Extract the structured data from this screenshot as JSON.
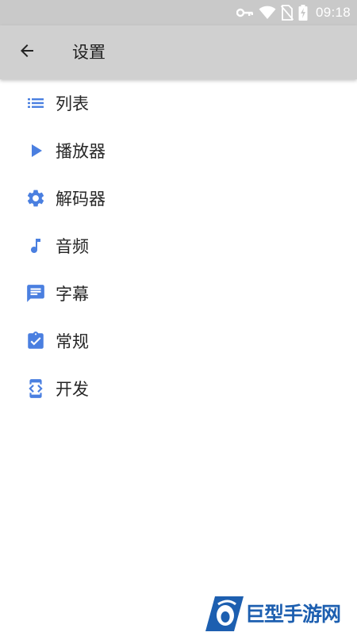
{
  "status_bar": {
    "time": "09:18",
    "icons": [
      "vpn-key-icon",
      "wifi-icon",
      "no-sim-icon",
      "battery-charging-icon"
    ]
  },
  "app_bar": {
    "back_icon": "arrow-back-icon",
    "title": "设置"
  },
  "menu": {
    "accent_color": "#4a7fe0",
    "items": [
      {
        "icon": "list-icon",
        "label": "列表"
      },
      {
        "icon": "play-icon",
        "label": "播放器"
      },
      {
        "icon": "gear-icon",
        "label": "解码器"
      },
      {
        "icon": "music-note-icon",
        "label": "音频"
      },
      {
        "icon": "subtitle-icon",
        "label": "字幕"
      },
      {
        "icon": "clipboard-check-icon",
        "label": "常规"
      },
      {
        "icon": "developer-mode-icon",
        "label": "开发"
      }
    ]
  },
  "watermark": {
    "text": "巨型手游网"
  }
}
